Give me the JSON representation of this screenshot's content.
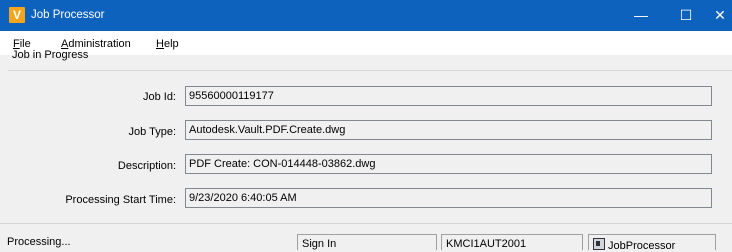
{
  "window": {
    "title": "Job Processor",
    "icon": "vault-v-icon",
    "minimize_glyph": "—",
    "maximize_glyph": "☐",
    "close_glyph": "✕"
  },
  "menu": {
    "file": {
      "accel": "F",
      "rest": "ile"
    },
    "administration": {
      "accel": "A",
      "rest": "dministration"
    },
    "help": {
      "accel": "H",
      "rest": "elp"
    }
  },
  "job_group": {
    "title": "Job in Progress",
    "fields": [
      {
        "label": "Job Id:",
        "value": "95560000119177"
      },
      {
        "label": "Job Type:",
        "value": "Autodesk.Vault.PDF.Create.dwg"
      },
      {
        "label": "Description:",
        "value": "PDF Create: CON-014448-03862.dwg"
      },
      {
        "label": "Processing Start Time:",
        "value": "9/23/2020 6:40:05 AM"
      }
    ]
  },
  "status_bar": {
    "status": "Processing...",
    "sign_in": "Sign In",
    "host": "KMCI1AUT2001",
    "processor_icon": "job-processor-icon",
    "processor": "JobProcessor"
  },
  "colors": {
    "titlebar": "#0d62bd",
    "window_bg": "#f0f0f0",
    "menubar_bg": "#ffffff",
    "field_border": "#828790"
  }
}
